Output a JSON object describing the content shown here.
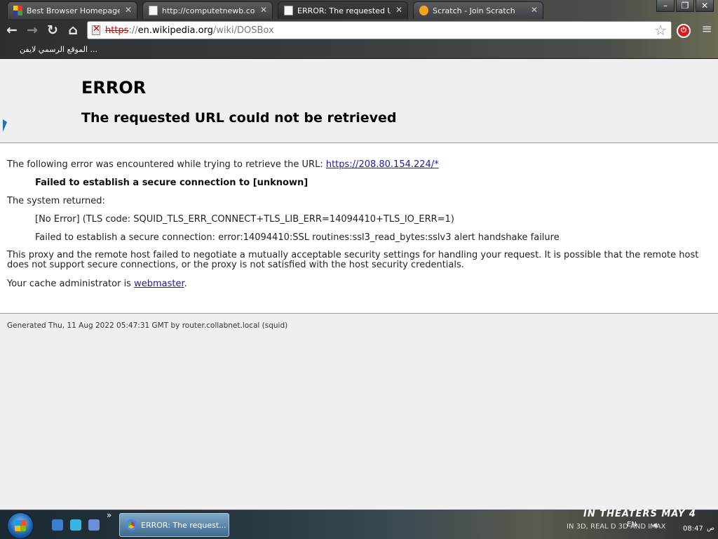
{
  "tabs": [
    {
      "title": "Best Browser Homepage, Cu",
      "favicon": "grid-icon"
    },
    {
      "title": "http://computetnewb.com/",
      "favicon": "page-icon"
    },
    {
      "title": "ERROR: The requested URL",
      "favicon": "page-icon",
      "active": true
    },
    {
      "title": "Scratch - Join Scratch",
      "favicon": "scratch-icon"
    }
  ],
  "address_bar": {
    "scheme": "https",
    "separator": "://",
    "host": "en.wikipedia.org",
    "path": "/wiki/DOSBox",
    "security_state": "broken-https"
  },
  "bookmarks": [
    {
      "label": "الموقع الرسمي لايفن ..."
    }
  ],
  "page": {
    "heading": "ERROR",
    "subheading": "The requested URL could not be retrieved",
    "para1_prefix": "The following error was encountered while trying to retrieve the URL: ",
    "para1_link": "https://208.80.154.224/*",
    "failed_line": "Failed to establish a secure connection to [unknown]",
    "system_returned": "The system returned:",
    "no_error_line": "[No Error] (TLS code: SQUID_TLS_ERR_CONNECT+TLS_LIB_ERR=14094410+TLS_IO_ERR=1)",
    "failed_detail_line": "Failed to establish a secure connection: error:14094410:SSL routines:ssl3_read_bytes:sslv3 alert handshake failure",
    "proxy_paragraph": "This proxy and the remote host failed to negotiate a mutually acceptable security settings for handling your request. It is possible that the remote host does not support secure connections, or the proxy is not satisfied with the host security credentials.",
    "admin_prefix": "Your cache administrator is ",
    "admin_link": "webmaster",
    "admin_suffix": ".",
    "footer": "Generated Thu, 11 Aug 2022 05:47:31 GMT by router.collabnet.local (squid)"
  },
  "taskbar": {
    "active_window": "ERROR: The request...",
    "wallpaper_text": "IN THEATERS MAY 4",
    "wallpaper_text2": "IN 3D, REAL D 3D AND IMAX",
    "language": "EN",
    "clock": "08:47",
    "clock_suffix": "ص"
  },
  "colors": {
    "link": "#1b1bb0",
    "broken_scheme": "#cc0000",
    "page_bg": "#efefef"
  }
}
